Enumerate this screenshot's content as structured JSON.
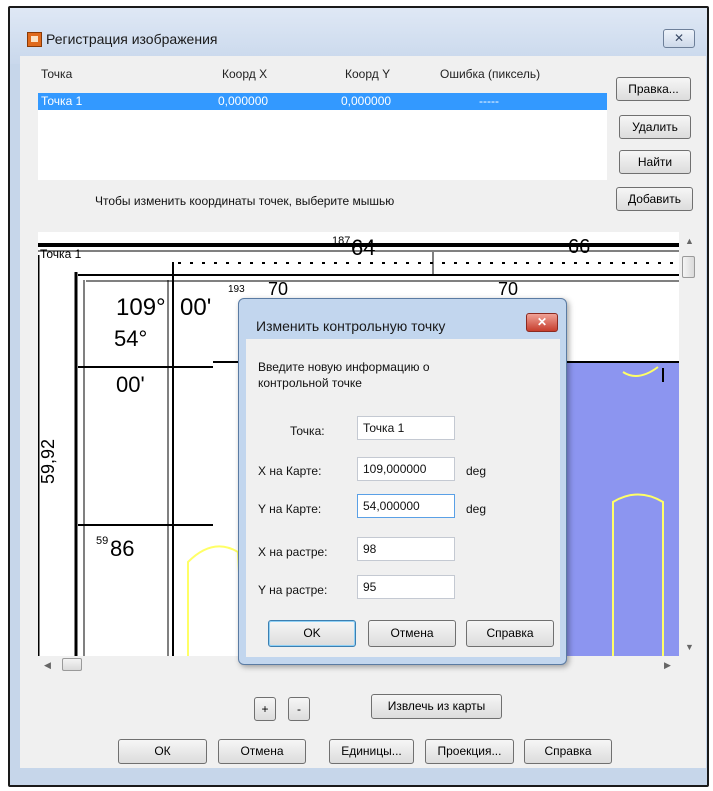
{
  "window": {
    "title": "Регистрация изображения",
    "close_glyph": "✕"
  },
  "points_table": {
    "headers": [
      "Точка",
      "Коорд X",
      "Коорд Y",
      "Ошибка (пиксель)"
    ],
    "rows": [
      {
        "point": "Точка 1",
        "x": "0,000000",
        "y": "0,000000",
        "error": "-----"
      }
    ]
  },
  "side_buttons": {
    "edit": "Правка...",
    "delete": "Удалить",
    "find": "Найти",
    "add": "Добавить"
  },
  "hint": "Чтобы изменить координаты точек, выберите мышью",
  "map": {
    "point_label": "Точка 1",
    "labels": {
      "top_187_64": "64",
      "top_187_sup": "187",
      "top_66": "66",
      "left_109": "109°",
      "left_00a": "00'",
      "left_54": "54°",
      "left_00b": "00'",
      "left_5992": "59,92",
      "left_5986_sup": "59",
      "left_5986": "86",
      "frag_70a": "70",
      "frag_70b": "70",
      "frag_193": "193"
    },
    "fill_color": "#8c95f0",
    "contour_color": "#ffff66"
  },
  "zoom": {
    "plus": "+",
    "minus": "-",
    "extract": "Извлечь из карты"
  },
  "bottom_buttons": {
    "ok": "ОК",
    "cancel": "Отмена",
    "units": "Единицы...",
    "projection": "Проекция...",
    "help": "Справка"
  },
  "dialog": {
    "title": "Изменить контрольную точку",
    "close_glyph": "✕",
    "description": [
      "Введите новую информацию о",
      "контрольной точке"
    ],
    "point_label": "Точка:",
    "point_value": "Точка 1",
    "map_x_label": "X на Карте:",
    "map_x_value": "109,000000",
    "map_x_unit": "deg",
    "map_y_label": "Y на Карте:",
    "map_y_value": "54,000000",
    "map_y_unit": "deg",
    "raster_x_label": "X на растре:",
    "raster_x_value": "98",
    "raster_y_label": "Y на растре:",
    "raster_y_value": "95",
    "ok": "OK",
    "cancel": "Отмена",
    "help": "Справка"
  },
  "colors": {
    "selection": "#3399ff",
    "dialog_frame": "#c2d6ee",
    "close_red": "#c63e2d"
  }
}
